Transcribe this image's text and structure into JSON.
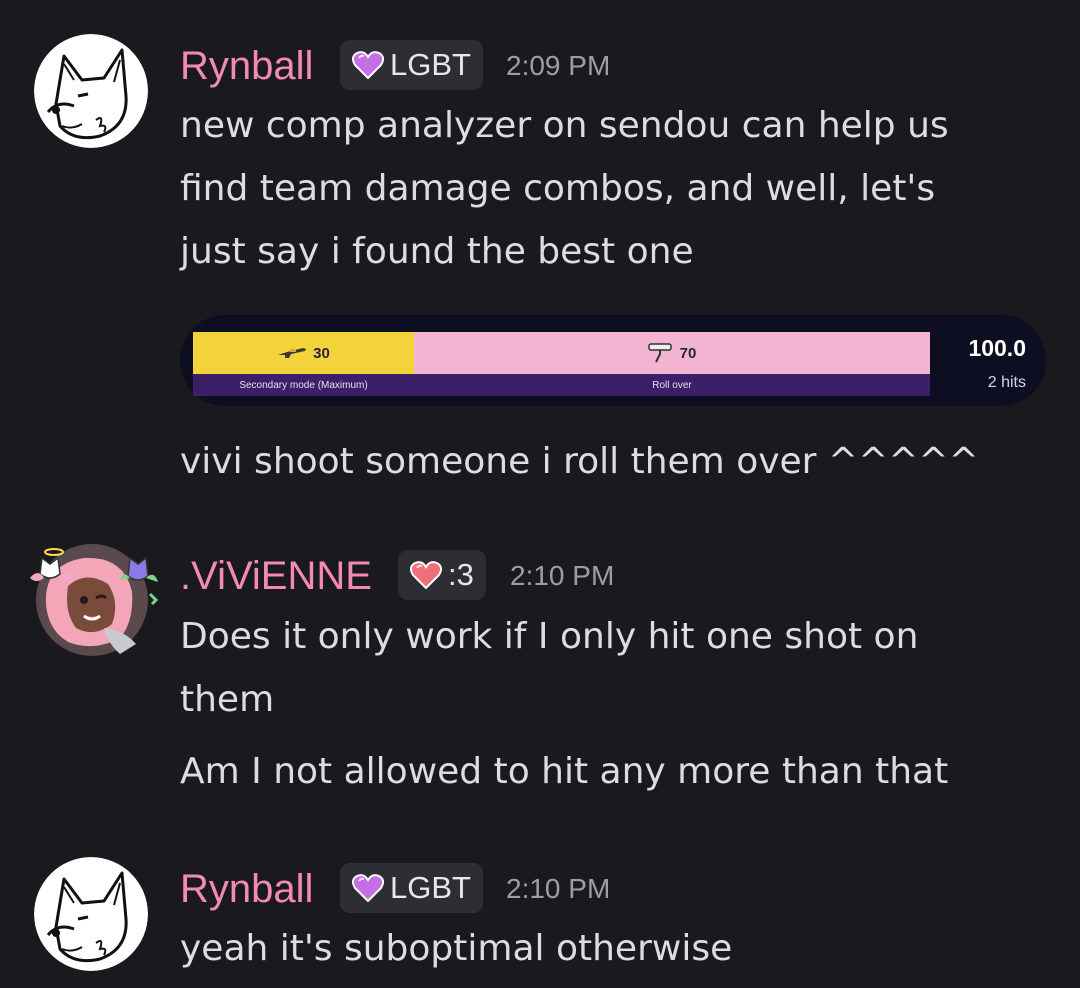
{
  "colors": {
    "background": "#1a1a1e",
    "username": "#f38ab5",
    "timestamp": "#9b9ea5",
    "text": "#dbdee1",
    "tag_bg": "#2d2e33",
    "bar_yellow": "#f2d43a",
    "bar_pink": "#f3b4d2",
    "bar_label_bg": "#3b1f69"
  },
  "messages": [
    {
      "username": "Rynball",
      "tag_icon": "purple-heart-icon",
      "tag_label": "LGBT",
      "time": "2:09 PM",
      "lines": [
        "new comp analyzer on sendou can help us",
        "find team damage combos, and well, let's",
        "just say i found the best one"
      ],
      "after_embed": "vivi shoot someone i roll them over ^^^^^"
    },
    {
      "username": ".ViViENNE",
      "tag_icon": "red-heart-icon",
      "tag_label": ":3",
      "time": "2:10 PM",
      "lines": [
        "Does it only work if I only hit one shot on",
        "them"
      ],
      "line2": "Am I not allowed to hit any more than that"
    },
    {
      "username": "Rynball",
      "tag_icon": "purple-heart-icon",
      "tag_label": "LGBT",
      "time": "2:10 PM",
      "lines": [
        "yeah it's suboptimal otherwise"
      ]
    }
  ],
  "damage_embed": {
    "segments": [
      {
        "icon": "sniper-weapon-icon",
        "value": "30",
        "label": "Secondary mode (Maximum)",
        "share": 0.3
      },
      {
        "icon": "roller-weapon-icon",
        "value": "70",
        "label": "Roll over",
        "share": 0.7
      }
    ],
    "total": "100.0",
    "hits": "2 hits"
  }
}
